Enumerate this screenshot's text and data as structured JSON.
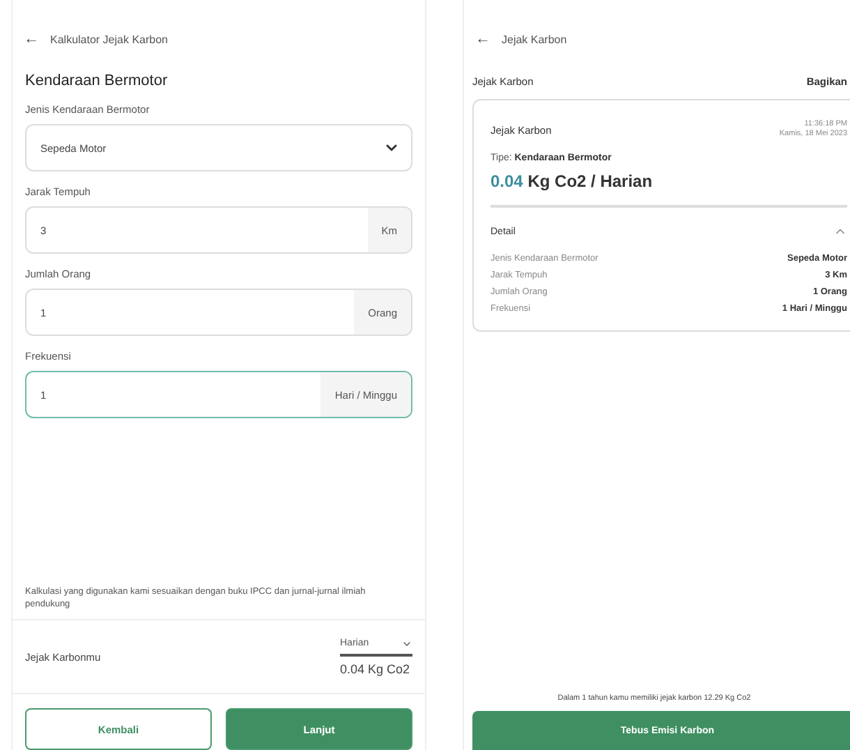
{
  "form_screen": {
    "header": {
      "back_icon": "←",
      "title": "Kalkulator Jejak Karbon"
    },
    "section_title": "Kendaraan Bermotor",
    "fields": [
      {
        "kind": "select",
        "label": "Jenis Kendaraan Bermotor",
        "value": "Sepeda Motor",
        "focused": false
      },
      {
        "kind": "input",
        "label": "Jarak Tempuh",
        "value": "3",
        "unit": "Km",
        "focused": false
      },
      {
        "kind": "input",
        "label": "Jumlah Orang",
        "value": "1",
        "unit": "Orang",
        "focused": false
      },
      {
        "kind": "input",
        "label": "Frekuensi",
        "value": "1",
        "unit": "Hari / Minggu",
        "focused": true
      }
    ],
    "note": "Kalkulasi yang digunakan kami sesuaikan dengan buku IPCC dan jurnal-jurnal ilmiah pendukung",
    "summary": {
      "label": "Jejak Karbonmu",
      "period": "Harian",
      "result": "0.04 Kg Co2"
    },
    "buttons": [
      {
        "label": "Kembali",
        "kind": "secondary"
      },
      {
        "label": "Lanjut",
        "kind": "primary"
      }
    ]
  },
  "result_screen": {
    "header": {
      "back_icon": "←",
      "title": "Jejak Karbon"
    },
    "title": "Jejak Karbon",
    "share": "Bagikan",
    "card": {
      "title": "Jejak Karbon",
      "time": "11:36:18 PM",
      "date": "Kamis, 18 Mei 2023",
      "type": "Tipe: **Kendaraan Bermotor**",
      "amount": "0.04",
      "amount_unit": "Kg Co2 / Harian",
      "detail": {
        "title": "Detail",
        "expanded": true,
        "rows": [
          {
            "label": "Jenis Kendaraan Bermotor",
            "value": "Sepeda Motor"
          },
          {
            "label": "Jarak Tempuh",
            "value": "3 Km"
          },
          {
            "label": "Jumlah Orang",
            "value": "1 Orang"
          },
          {
            "label": "Frekuensi",
            "value": "1 Hari / Minggu"
          }
        ]
      }
    },
    "yearly_note": "Dalam 1 tahun kamu memiliki jejak karbon 12.29 Kg Co2",
    "button": "Tebus Emisi Karbon"
  }
}
